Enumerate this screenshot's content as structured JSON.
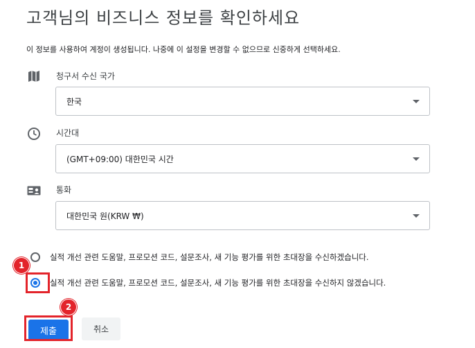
{
  "page": {
    "title": "고객님의 비즈니스 정보를 확인하세요",
    "subtitle": "이 정보를 사용하여 계정이 생성됩니다. 나중에 이 설정을 변경할 수 없으므로 신중하게 선택하세요."
  },
  "fields": {
    "country": {
      "label": "청구서 수신 국가",
      "value": "한국",
      "icon": "map-icon"
    },
    "timezone": {
      "label": "시간대",
      "value": "(GMT+09:00) 대한민국 시간",
      "icon": "clock-icon"
    },
    "currency": {
      "label": "통화",
      "value": "대한민국 원(KRW ₩)",
      "icon": "currency-card-icon"
    }
  },
  "options": {
    "opt_in": {
      "label": "실적 개선 관련 도움말, 프로모션 코드, 설문조사, 새 기능 평가를 위한 초대장을 수신하겠습니다.",
      "checked": false
    },
    "opt_out": {
      "label": "실적 개선 관련 도움말, 프로모션 코드, 설문조사, 새 기능 평가를 위한 초대장을 수신하지 않겠습니다.",
      "checked": true
    }
  },
  "buttons": {
    "submit": "제출",
    "cancel": "취소"
  },
  "annotations": {
    "step1": "1",
    "step2": "2",
    "color": "#e3242b"
  },
  "colors": {
    "accent": "#1a73e8",
    "text": "#202124",
    "muted": "#5f6368"
  }
}
